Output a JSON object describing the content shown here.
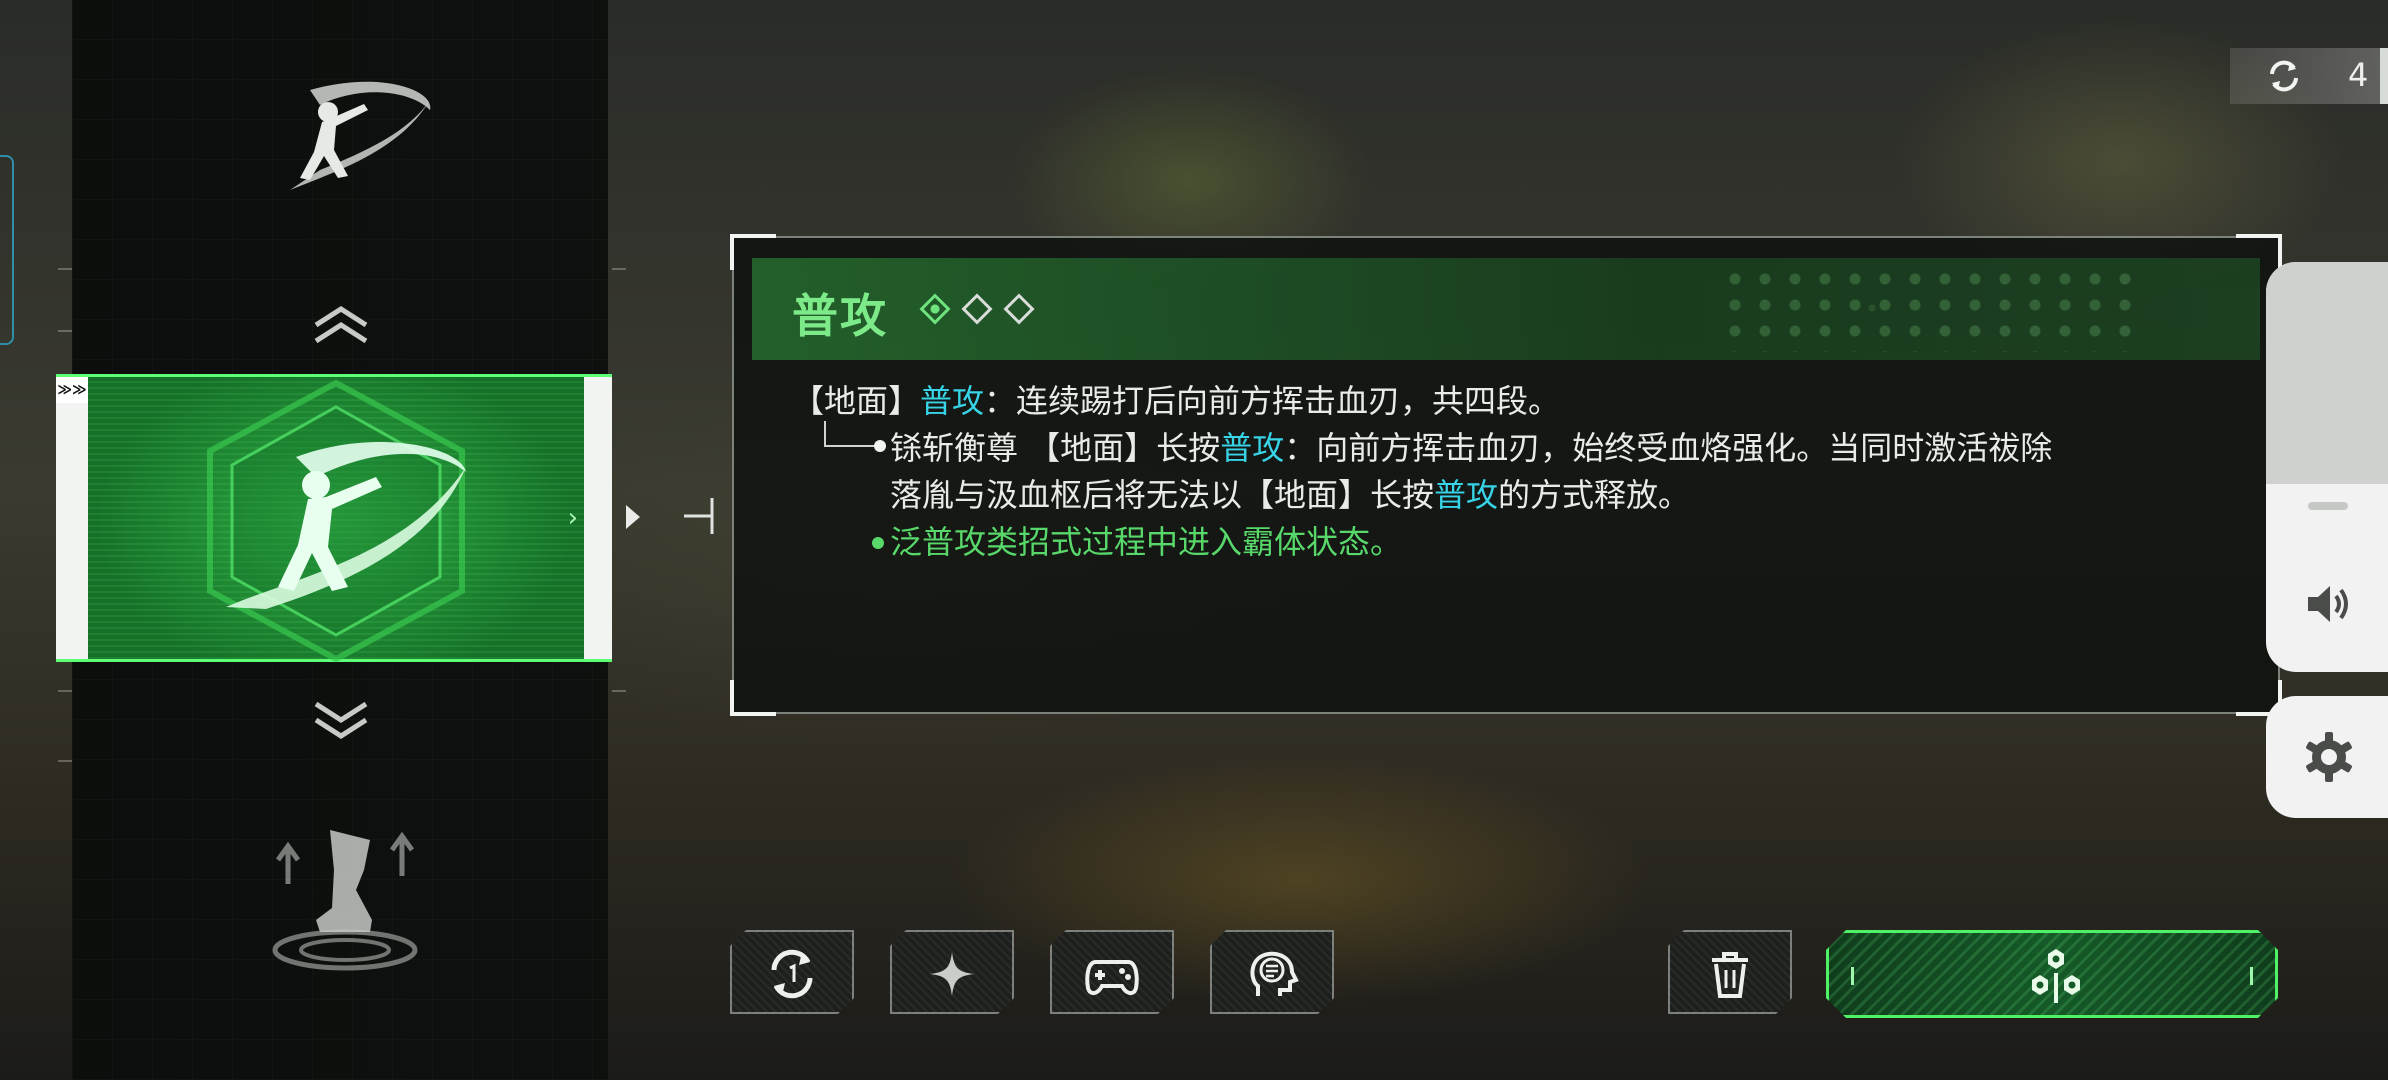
{
  "status": {
    "counter_value": "4"
  },
  "skill_list": {
    "selected_tag": "≫≫",
    "items": [
      {
        "name": "slash-skill",
        "state": "normal"
      },
      {
        "name": "slash-skill",
        "state": "selected"
      },
      {
        "name": "kick-skill",
        "state": "normal"
      }
    ]
  },
  "skill_detail": {
    "title": "普攻",
    "level_total": 3,
    "level_current": 1,
    "line1": {
      "prefix": "【地面】",
      "highlight": "普攻",
      "text": "：连续踢打后向前方挥击血刃，共四段。"
    },
    "line2": {
      "a": "铩斩衡尊 【地面】长按",
      "highlight": "普攻",
      "b": "：向前方挥击血刃，始终受血烙强化。当同时激活祓除"
    },
    "line3": {
      "a": "落胤与汲血枢后将无法以【地面】长按",
      "highlight": "普攻",
      "b": "的方式释放。"
    },
    "line4": "泛普攻类招式过程中进入霸体状态。"
  },
  "colors": {
    "accent_green": "#58d86a",
    "title_green": "#7dea8a",
    "highlight_cyan": "#37d3e6",
    "button_border_green": "#4ff266"
  },
  "icons": {
    "counter": "refresh-icon",
    "volume": "speaker-icon",
    "settings": "gear-icon",
    "action_buttons": [
      "replace-icon",
      "sparkle-icon",
      "gamepad-icon",
      "head-info-icon"
    ],
    "delete": "trash-icon",
    "confirm": "hexagon-cluster-icon"
  }
}
